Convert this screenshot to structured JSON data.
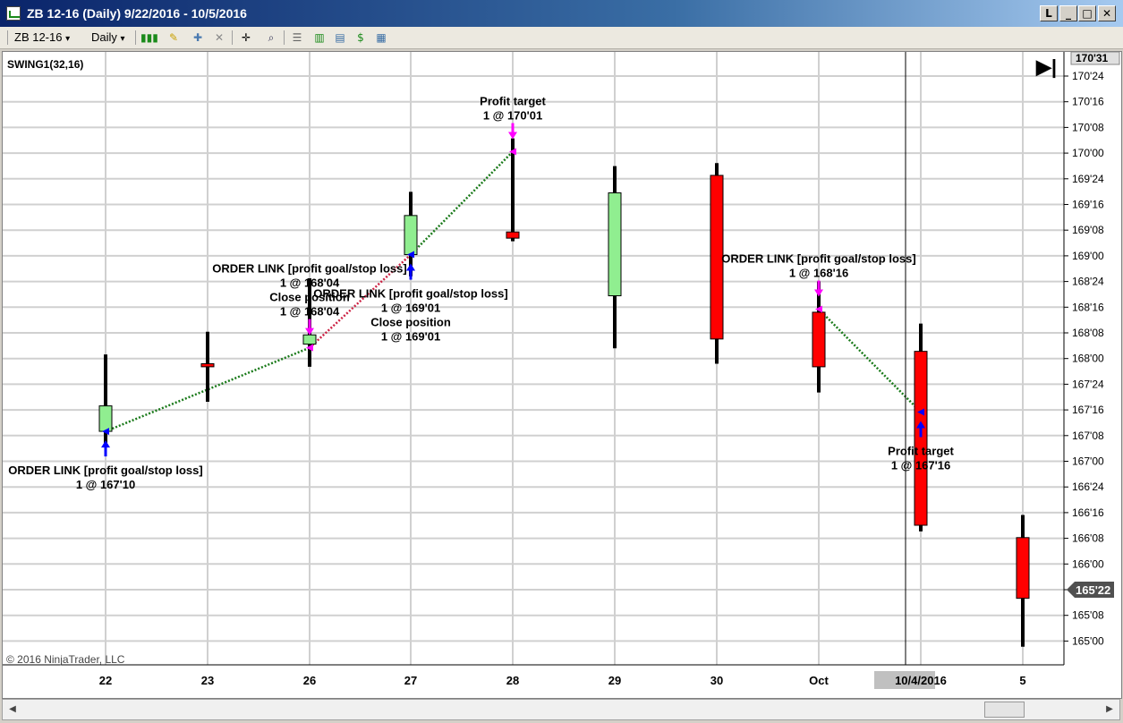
{
  "window": {
    "title": "ZB 12-16 (Daily)  9/22/2016 - 10/5/2016",
    "buttons": [
      "L",
      "_",
      "□",
      "✕"
    ]
  },
  "toolbar": {
    "instrument": "ZB 12-16",
    "interval": "Daily",
    "dropdown_arrow": "▾"
  },
  "chart": {
    "indicator_label": "SWING1(32,16)",
    "copyright": "© 2016 NinjaTrader, LLC",
    "scroll_end_glyph": "▶|",
    "crosshair_date": "10/4/2016",
    "price_axis_labels": [
      "170'24",
      "170'16",
      "170'08",
      "170'00",
      "169'24",
      "169'16",
      "169'08",
      "169'00",
      "168'24",
      "168'16",
      "168'08",
      "168'00",
      "167'24",
      "167'16",
      "167'08",
      "167'00",
      "166'24",
      "166'16",
      "166'08",
      "166'00",
      "165'16",
      "165'08",
      "165'00"
    ],
    "top_price_tag": "170'31",
    "last_price_tag": "165'22",
    "date_axis_labels": [
      "22",
      "23",
      "26",
      "27",
      "28",
      "29",
      "30",
      "Oct",
      "10/4/2016",
      "5"
    ],
    "annotations": [
      {
        "lines": [
          "ORDER LINK [profit goal/stop loss]",
          "1 @ 167'10"
        ]
      },
      {
        "lines": [
          "ORDER LINK [profit goal/stop loss]",
          "1 @ 168'04",
          "Close position",
          "1 @ 168'04"
        ]
      },
      {
        "lines": [
          "ORDER LINK [profit goal/stop loss]",
          "1 @ 169'01",
          "Close position",
          "1 @ 169'01"
        ]
      },
      {
        "lines": [
          "Profit target",
          "1 @ 170'01"
        ]
      },
      {
        "lines": [
          "ORDER LINK [profit goal/stop loss]",
          "1 @ 168'16"
        ]
      },
      {
        "lines": [
          "Profit target",
          "1 @ 167'16"
        ]
      }
    ]
  },
  "chart_data": {
    "type": "candlestick",
    "title": "ZB 12-16 (Daily)  9/22/2016 - 10/5/2016",
    "price_unit_note": "prices in 32nds as printed, e.g. 167'10 = 167 + 10/32",
    "ylim": [
      "165'00",
      "170'31"
    ],
    "categories": [
      "22",
      "23",
      "26",
      "27",
      "28",
      "29",
      "30",
      "Oct",
      "10/4/2016",
      "5"
    ],
    "bars": [
      {
        "date": "22",
        "open": "167'10",
        "high": "168'02",
        "low": "167'16",
        "close": "167'18",
        "open_v": 167.3125,
        "high_v": 168.06,
        "low_v": 167.16,
        "close_v": 167.56
      },
      {
        "date": "23",
        "open": "167'31",
        "high": "168'09",
        "low": "167'19",
        "close": "167'30",
        "open_v": 167.97,
        "high_v": 168.28,
        "low_v": 167.6,
        "close_v": 167.94
      },
      {
        "date": "26",
        "open": "168'05",
        "high": "168'26",
        "low": "167'30",
        "close": "168'08",
        "open_v": 168.16,
        "high_v": 168.8,
        "low_v": 167.94,
        "close_v": 168.25
      },
      {
        "date": "27",
        "open": "169'01",
        "high": "169'20",
        "low": "168'27",
        "close": "169'13",
        "open_v": 169.03,
        "high_v": 169.64,
        "low_v": 168.82,
        "close_v": 169.41
      },
      {
        "date": "28",
        "open": "169'08",
        "high": "170'05",
        "low": "169'05",
        "close": "169'06",
        "open_v": 169.25,
        "high_v": 170.16,
        "low_v": 169.16,
        "close_v": 169.19
      },
      {
        "date": "29",
        "open": "168'20",
        "high": "169'28",
        "low": "168'03",
        "close": "169'20",
        "open_v": 168.63,
        "high_v": 169.89,
        "low_v": 168.12,
        "close_v": 169.63
      },
      {
        "date": "30",
        "open": "169'26",
        "high": "169'30",
        "low": "167'31",
        "close": "168'07",
        "open_v": 169.8,
        "high_v": 169.92,
        "low_v": 167.97,
        "close_v": 168.21
      },
      {
        "date": "Oct",
        "open": "168'15",
        "high": "168'25",
        "low": "167'22",
        "close": "167'30",
        "open_v": 168.47,
        "high_v": 168.77,
        "low_v": 167.69,
        "close_v": 167.94
      },
      {
        "date": "10/4/2016",
        "open": "168'03",
        "high": "168'11",
        "low": "166'11",
        "close": "166'13",
        "open_v": 168.09,
        "high_v": 168.36,
        "low_v": 166.34,
        "close_v": 166.4
      },
      {
        "date": "5",
        "open": "166'09",
        "high": "166'16",
        "low": "165'07",
        "close": "165'22",
        "open_v": 166.28,
        "high_v": 166.5,
        "low_v": 165.22,
        "close_v": 165.69
      }
    ],
    "trade_lines": [
      {
        "from_date": "22",
        "from_price": 167.3125,
        "to_date": "26",
        "to_price": 168.125,
        "color": "#1a7a1a"
      },
      {
        "from_date": "26",
        "from_price": 168.125,
        "to_date": "27",
        "to_price": 169.03,
        "color": "#cc2244"
      },
      {
        "from_date": "27",
        "from_price": 169.03,
        "to_date": "28",
        "to_price": 170.03,
        "color": "#1a7a1a"
      },
      {
        "from_date": "Oct",
        "from_price": 168.5,
        "to_date": "10/4/2016",
        "to_price": 167.5,
        "color": "#1a7a1a"
      }
    ],
    "arrows": [
      {
        "date": "22",
        "direction": "up",
        "price": 167.3125,
        "color": "#0000ff",
        "annotation": 0
      },
      {
        "date": "26",
        "direction": "down",
        "price": 168.125,
        "color": "#ff00ff",
        "annotation": 1
      },
      {
        "date": "27",
        "direction": "up",
        "price": 169.03,
        "color": "#0000ff",
        "annotation": 2
      },
      {
        "date": "28",
        "direction": "down",
        "price": 170.03,
        "color": "#ff00ff",
        "annotation": 3
      },
      {
        "date": "Oct",
        "direction": "down",
        "price": 168.5,
        "color": "#ff00ff",
        "annotation": 4
      },
      {
        "date": "10/4/2016",
        "direction": "up",
        "price": 167.5,
        "color": "#0000ff",
        "annotation": 5
      }
    ],
    "colors": {
      "up": "#90ee90",
      "down": "#ff0000",
      "wick": "#000000",
      "grid": "#d0d0d0"
    },
    "grid": true
  }
}
